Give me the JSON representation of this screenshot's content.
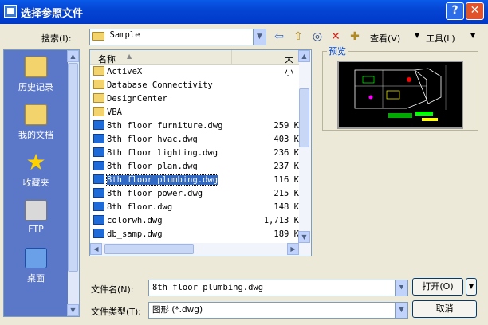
{
  "window": {
    "title": "选择参照文件",
    "help_label": "?",
    "close_label": "✕"
  },
  "search": {
    "label": "搜索(I):",
    "value": "Sample"
  },
  "toolbar": {
    "view_label": "查看(V)",
    "tools_label": "工具(L)"
  },
  "places": [
    {
      "label": "历史记录",
      "icon": "history-folder-icon"
    },
    {
      "label": "我的文档",
      "icon": "my-documents-icon"
    },
    {
      "label": "收藏夹",
      "icon": "favorites-star-icon"
    },
    {
      "label": "FTP",
      "icon": "ftp-icon"
    },
    {
      "label": "桌面",
      "icon": "desktop-icon"
    }
  ],
  "columns": {
    "name": "名称",
    "size": "大小"
  },
  "files": [
    {
      "name": "ActiveX",
      "size": "",
      "type": "folder"
    },
    {
      "name": "Database Connectivity",
      "size": "",
      "type": "folder"
    },
    {
      "name": "DesignCenter",
      "size": "",
      "type": "folder"
    },
    {
      "name": "VBA",
      "size": "",
      "type": "folder"
    },
    {
      "name": "8th floor furniture.dwg",
      "size": "259 K",
      "type": "dwg"
    },
    {
      "name": "8th floor hvac.dwg",
      "size": "403 K",
      "type": "dwg"
    },
    {
      "name": "8th floor lighting.dwg",
      "size": "236 K",
      "type": "dwg"
    },
    {
      "name": "8th floor plan.dwg",
      "size": "237 K",
      "type": "dwg"
    },
    {
      "name": "8th floor plumbing.dwg",
      "size": "116 K",
      "type": "dwg",
      "selected": true
    },
    {
      "name": "8th floor power.dwg",
      "size": "215 K",
      "type": "dwg"
    },
    {
      "name": "8th floor.dwg",
      "size": "148 K",
      "type": "dwg"
    },
    {
      "name": "colorwh.dwg",
      "size": "1,713 K",
      "type": "dwg"
    },
    {
      "name": "db_samp.dwg",
      "size": "189 K",
      "type": "dwg"
    }
  ],
  "preview": {
    "label": "预览"
  },
  "filename": {
    "label": "文件名(N):",
    "value": "8th floor plumbing.dwg"
  },
  "filetype": {
    "label": "文件类型(T):",
    "value": "图形 (*.dwg)"
  },
  "buttons": {
    "open": "打开(O)",
    "cancel": "取消"
  },
  "colors": {
    "titlebar": "#0a5ae8",
    "places_bg": "#5b78c8",
    "selection": "#316ac5"
  }
}
